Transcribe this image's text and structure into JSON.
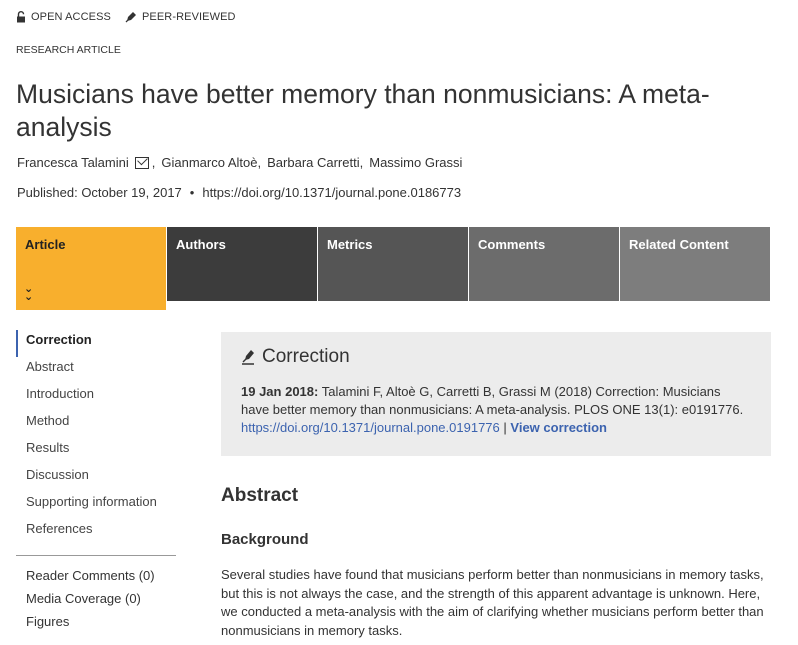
{
  "badges": {
    "open_access": "OPEN ACCESS",
    "peer_reviewed": "PEER-REVIEWED"
  },
  "article_type": "RESEARCH ARTICLE",
  "title": "Musicians have better memory than nonmusicians: A meta-analysis",
  "authors": [
    "Francesca Talamini",
    "Gianmarco Altoè",
    "Barbara Carretti",
    "Massimo Grassi"
  ],
  "published": "Published: October 19, 2017",
  "doi": "https://doi.org/10.1371/journal.pone.0186773",
  "tabs": [
    "Article",
    "Authors",
    "Metrics",
    "Comments",
    "Related Content"
  ],
  "sidebar": {
    "items": [
      "Correction",
      "Abstract",
      "Introduction",
      "Method",
      "Results",
      "Discussion",
      "Supporting information",
      "References"
    ],
    "extras": [
      "Reader Comments (0)",
      "Media Coverage (0)",
      "Figures"
    ]
  },
  "correction": {
    "heading": "Correction",
    "date": "19 Jan 2018:",
    "text": "Talamini F, Altoè G, Carretti B, Grassi M (2018) Correction: Musicians have better memory than nonmusicians: A meta-analysis. PLOS ONE 13(1): e0191776.",
    "doi": "https://doi.org/10.1371/journal.pone.0191776",
    "separator": "|",
    "view_label": "View correction"
  },
  "abstract": {
    "heading": "Abstract",
    "background_heading": "Background",
    "background_text": "Several studies have found that musicians perform better than nonmusicians in memory tasks, but this is not always the case, and the strength of this apparent advantage is unknown. Here, we conducted a meta-analysis with the aim of clarifying whether musicians perform better than nonmusicians in memory tasks."
  },
  "colors": {
    "active_tab": "#f8af2d",
    "link": "#3c63af",
    "correction_bg": "#ececec"
  }
}
